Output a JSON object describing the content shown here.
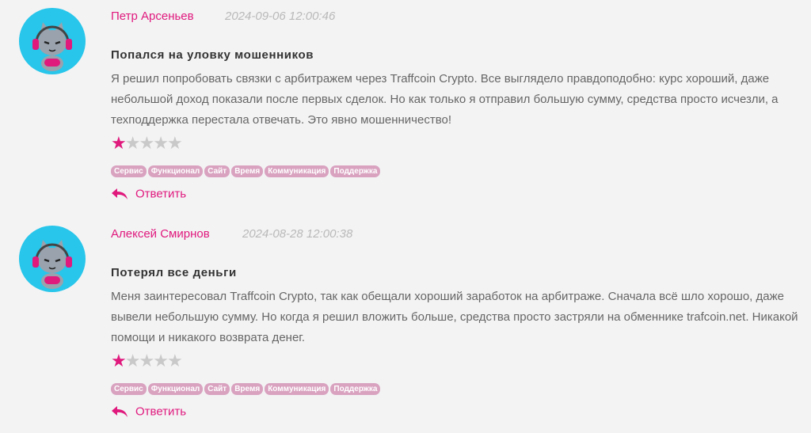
{
  "reviews": [
    {
      "author": "Петр Арсеньев",
      "date": "2024-09-06 12:00:46",
      "title": "Попался на уловку мошенников",
      "text": "Я решил попробовать связки с арбитражем через Traffcoin Crypto. Все выглядело правдоподобно: курс хороший, даже небольшой доход показали после первых сделок. Но как только я отправил большую сумму, средства просто исчезли, а техподдержка перестала отвечать. Это явно мошенничество!",
      "rating": 1,
      "rating_max": 5,
      "tags": [
        "Сервис",
        "Функционал",
        "Сайт",
        "Время",
        "Коммуникация",
        "Поддержка"
      ],
      "reply_label": "Ответить"
    },
    {
      "author": "Алексей Смирнов",
      "date": "2024-08-28 12:00:38",
      "title": "Потерял все деньги",
      "text": "Меня заинтересовал Traffcoin Crypto, так как обещали хороший заработок на арбитраже. Сначала всё шло хорошо, даже вывели небольшую сумму. Но когда я решил вложить больше, средства просто застряли на обменнике trafcoin.net. Никакой помощи и никакого возврата денег.",
      "rating": 1,
      "rating_max": 5,
      "tags": [
        "Сервис",
        "Функционал",
        "Сайт",
        "Время",
        "Коммуникация",
        "Поддержка"
      ],
      "reply_label": "Ответить"
    }
  ],
  "icons": {
    "avatar": "gamer-cat-avatar-icon",
    "reply": "reply-arrow-icon",
    "star": "star-icon"
  },
  "colors": {
    "accent": "#e0197d",
    "avatar_bg": "#27c6ea",
    "tag_bg": "#d9a3c0",
    "star_off": "#c9c9c9"
  }
}
